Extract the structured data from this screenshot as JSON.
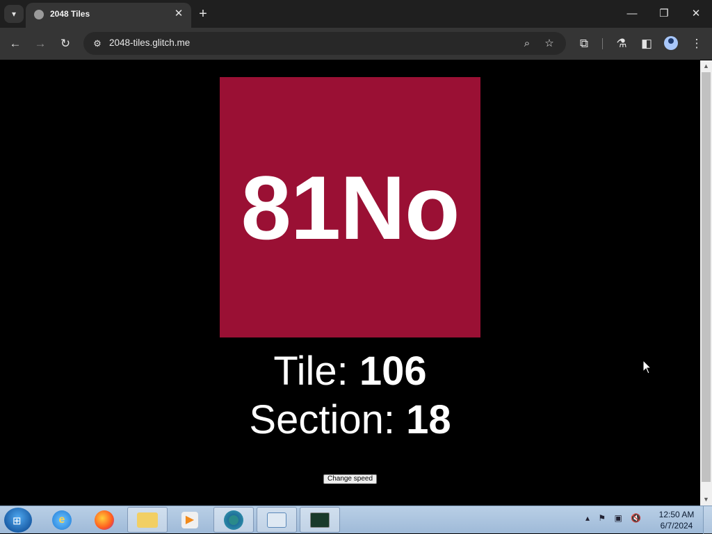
{
  "browser": {
    "tab_title": "2048 Tiles",
    "url": "2048-tiles.glitch.me",
    "tab_close_glyph": "✕",
    "new_tab_glyph": "+",
    "icons": [
      "tab-search-icon",
      "globe-icon",
      "back-icon",
      "forward-icon",
      "reload-icon",
      "site-info-icon",
      "zoom-icon",
      "star-icon",
      "extensions-icon",
      "labs-icon",
      "side-panel-icon",
      "profile-icon",
      "menu-icon",
      "minimize-icon",
      "restore-icon",
      "close-icon"
    ]
  },
  "game": {
    "tile_text": "81No",
    "tile_color": "#9a1034",
    "tile_label": "Tile: ",
    "tile_number": "106",
    "section_label": "Section: ",
    "section_number": "18",
    "change_speed_label": "Change speed"
  },
  "taskbar": {
    "time": "12:50 AM",
    "date": "6/7/2024",
    "apps": [
      "start-button",
      "internet-explorer-icon",
      "firefox-icon",
      "file-explorer-icon",
      "media-player-icon",
      "chrome-app-icon",
      "control-panel-icon",
      "task-manager-icon"
    ]
  }
}
